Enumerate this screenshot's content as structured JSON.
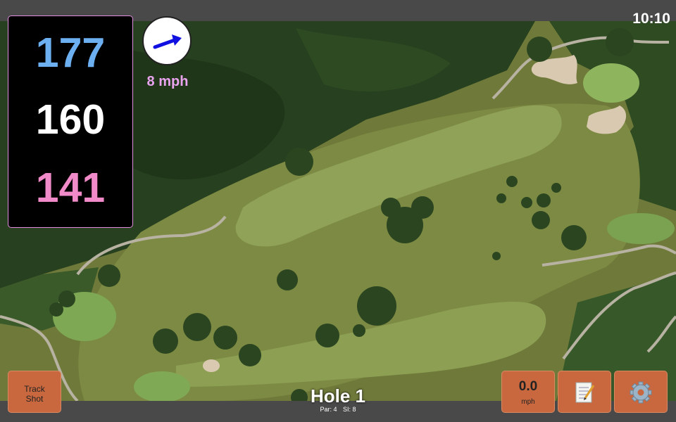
{
  "status_bar": {
    "time": "10:10"
  },
  "distances": {
    "back": "177",
    "middle": "160",
    "front": "141"
  },
  "wind": {
    "speed_label": "8 mph",
    "icon": "wind-direction-arrow-icon"
  },
  "hole": {
    "title": "Hole 1",
    "par": "Par: 4",
    "stroke_index": "SI: 8"
  },
  "buttons": {
    "track_shot_line1": "Track",
    "track_shot_line2": "Shot",
    "speed_value": "0.0",
    "speed_unit": "mph",
    "notes_icon": "notepad-icon",
    "settings_icon": "gear-icon"
  },
  "colors": {
    "back_distance": "#6db0f2",
    "middle_distance": "#ffffff",
    "front_distance": "#f08ac8",
    "wind_label": "#e9a3ef",
    "button": "#c9683e",
    "panel_border": "#e08de0"
  }
}
